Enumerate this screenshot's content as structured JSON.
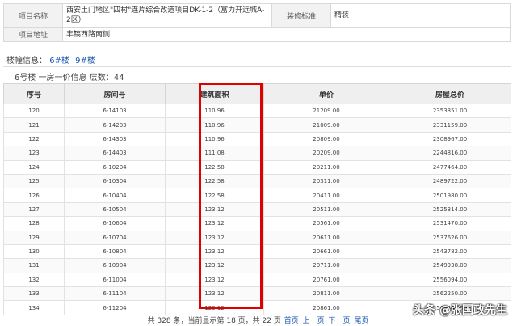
{
  "project": {
    "name_label": "项目名称",
    "name_value": "西安土门地区\"四村\"连片综合改造项目DK-1-2（富力开远城A-2区）",
    "decoration_label": "装修标准",
    "decoration_value": "精装",
    "address_label": "项目地址",
    "address_value": "丰镐西路南侧"
  },
  "buildings": {
    "label": "楼幢信息：",
    "links": [
      "6#楼",
      "9#楼"
    ]
  },
  "unit_title": "6号楼 一房一价信息 层数：44",
  "table": {
    "headers": [
      "序号",
      "房间号",
      "建筑面积",
      "单价",
      "房屋总价"
    ],
    "rows": [
      [
        "120",
        "6-14103",
        "110.96",
        "21209.00",
        "2353351.00"
      ],
      [
        "121",
        "6-14203",
        "110.96",
        "21009.00",
        "2331159.00"
      ],
      [
        "122",
        "6-14303",
        "110.96",
        "20809.00",
        "2308967.00"
      ],
      [
        "123",
        "6-14403",
        "111.08",
        "20209.00",
        "2244816.00"
      ],
      [
        "124",
        "6-10204",
        "122.58",
        "20211.00",
        "2477464.00"
      ],
      [
        "125",
        "6-10304",
        "122.58",
        "20311.00",
        "2489722.00"
      ],
      [
        "126",
        "6-10404",
        "122.58",
        "20411.00",
        "2501980.00"
      ],
      [
        "127",
        "6-10504",
        "123.12",
        "20511.00",
        "2525314.00"
      ],
      [
        "128",
        "6-10604",
        "123.12",
        "20561.00",
        "2531470.00"
      ],
      [
        "129",
        "6-10704",
        "123.12",
        "20611.00",
        "2537626.00"
      ],
      [
        "130",
        "6-10804",
        "123.12",
        "20661.00",
        "2543782.00"
      ],
      [
        "131",
        "6-10904",
        "123.12",
        "20711.00",
        "2549938.00"
      ],
      [
        "132",
        "6-11004",
        "123.12",
        "20761.00",
        "2556094.00"
      ],
      [
        "133",
        "6-11104",
        "123.12",
        "20811.00",
        "2562250.00"
      ],
      [
        "134",
        "6-11204",
        "123.12",
        "20861.00",
        "2568406.00"
      ]
    ]
  },
  "pager": {
    "summary": "共 328 条，当前显示第 18 页，共 22 页",
    "first": "首页",
    "prev": "上一页",
    "next": "下一页",
    "last": "尾页"
  },
  "watermark": "头条 @张国政先生",
  "colors": {
    "highlight": "#e00000",
    "link": "#1a56b0"
  }
}
